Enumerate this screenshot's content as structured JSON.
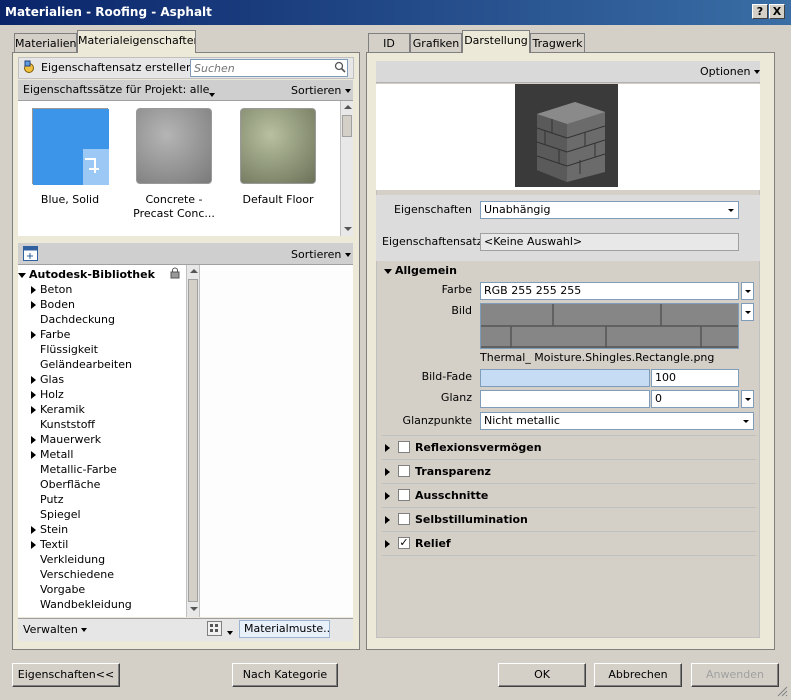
{
  "window": {
    "title": "Materialien - Roofing - Asphalt",
    "help_btn": "?",
    "close_btn": "X"
  },
  "left_tabs": [
    "Materialien",
    "Materialeigenschaften"
  ],
  "right_tabs": [
    "ID",
    "Grafiken",
    "Darstellung",
    "Tragwerk"
  ],
  "left": {
    "create_label": "Eigenschaftensatz erstellen",
    "search_placeholder": "Suchen",
    "project_sets_label": "Eigenschaftssätze für Projekt: alle",
    "sort_label": "Sortieren",
    "thumbs": [
      {
        "label1": "Blue, Solid",
        "label2": ""
      },
      {
        "label1": "Concrete -",
        "label2": "Precast Conc..."
      },
      {
        "label1": "Default Floor",
        "label2": ""
      }
    ],
    "library_sort_label": "Sortieren",
    "library_title": "Autodesk-Bibliothek",
    "tree": [
      {
        "label": "Beton",
        "expandable": true
      },
      {
        "label": "Boden",
        "expandable": true
      },
      {
        "label": "Dachdeckung",
        "expandable": false
      },
      {
        "label": "Farbe",
        "expandable": true
      },
      {
        "label": "Flüssigkeit",
        "expandable": false
      },
      {
        "label": "Geländearbeiten",
        "expandable": false
      },
      {
        "label": "Glas",
        "expandable": true
      },
      {
        "label": "Holz",
        "expandable": true
      },
      {
        "label": "Keramik",
        "expandable": true
      },
      {
        "label": "Kunststoff",
        "expandable": false
      },
      {
        "label": "Mauerwerk",
        "expandable": true
      },
      {
        "label": "Metall",
        "expandable": true
      },
      {
        "label": "Metallic-Farbe",
        "expandable": false
      },
      {
        "label": "Oberfläche",
        "expandable": false
      },
      {
        "label": "Putz",
        "expandable": false
      },
      {
        "label": "Spiegel",
        "expandable": false
      },
      {
        "label": "Stein",
        "expandable": true
      },
      {
        "label": "Textil",
        "expandable": true
      },
      {
        "label": "Verkleidung",
        "expandable": false
      },
      {
        "label": "Verschiedene",
        "expandable": false
      },
      {
        "label": "Vorgabe",
        "expandable": false
      },
      {
        "label": "Wandbekleidung",
        "expandable": false
      }
    ],
    "manage_label": "Verwalten",
    "material_pattern_label": "Materialmuste..."
  },
  "right": {
    "options_label": "Optionen",
    "eigenschaften_label": "Eigenschaften",
    "eigenschaften_value": "Unabhängig",
    "eigenschaftensatz_label": "Eigenschaftensatz",
    "eigenschaftensatz_value": "<Keine Auswahl>",
    "section_general": "Allgemein",
    "farbe_label": "Farbe",
    "farbe_value": "RGB 255 255 255",
    "bild_label": "Bild",
    "bild_filename": "Thermal_ Moisture.Shingles.Rectangle.png",
    "bildfade_label": "Bild-Fade",
    "bildfade_value": "100",
    "glanz_label": "Glanz",
    "glanz_value": "0",
    "glanzpunkte_label": "Glanzpunkte",
    "glanzpunkte_value": "Nicht metallic",
    "sections": [
      {
        "label": "Reflexionsvermögen",
        "checked": false
      },
      {
        "label": "Transparenz",
        "checked": false
      },
      {
        "label": "Ausschnitte",
        "checked": false
      },
      {
        "label": "Selbstillumination",
        "checked": false
      },
      {
        "label": "Relief",
        "checked": true
      }
    ]
  },
  "buttons": {
    "properties": "Eigenschaften<<",
    "by_category": "Nach Kategorie",
    "ok": "OK",
    "cancel": "Abbrechen",
    "apply": "Anwenden"
  }
}
